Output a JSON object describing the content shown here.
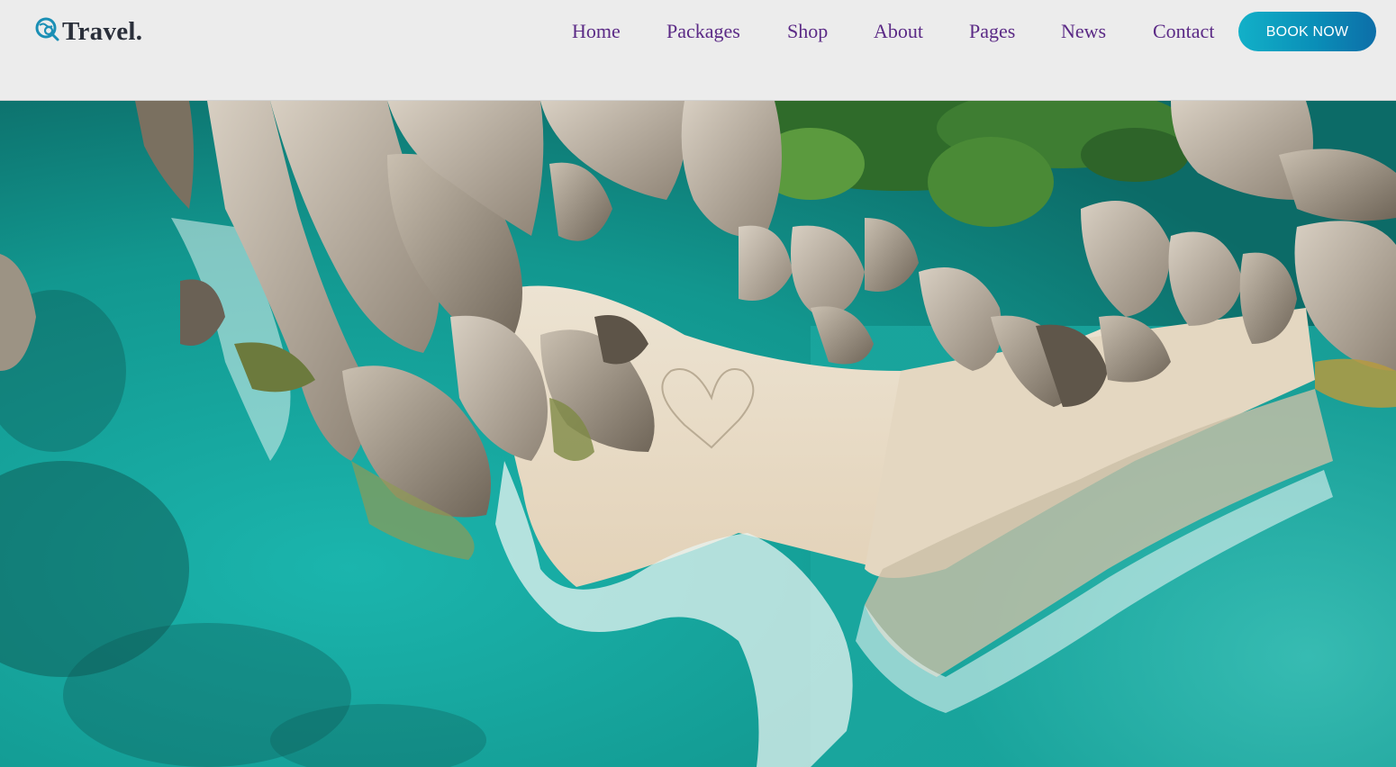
{
  "brand": {
    "name": "Travel.",
    "icon": "globe-search-icon",
    "icon_color": "#1a8fb5"
  },
  "nav": {
    "items": [
      {
        "label": "Home"
      },
      {
        "label": "Packages"
      },
      {
        "label": "Shop"
      },
      {
        "label": "About"
      },
      {
        "label": "Pages"
      },
      {
        "label": "News"
      },
      {
        "label": "Contact"
      }
    ],
    "link_color": "#5b2a86"
  },
  "cta": {
    "label": "BOOK NOW",
    "gradient": [
      "#12b0c8",
      "#0d6ea8"
    ]
  },
  "hero": {
    "image": "aerial-beach-rocks-turquoise-sea"
  }
}
